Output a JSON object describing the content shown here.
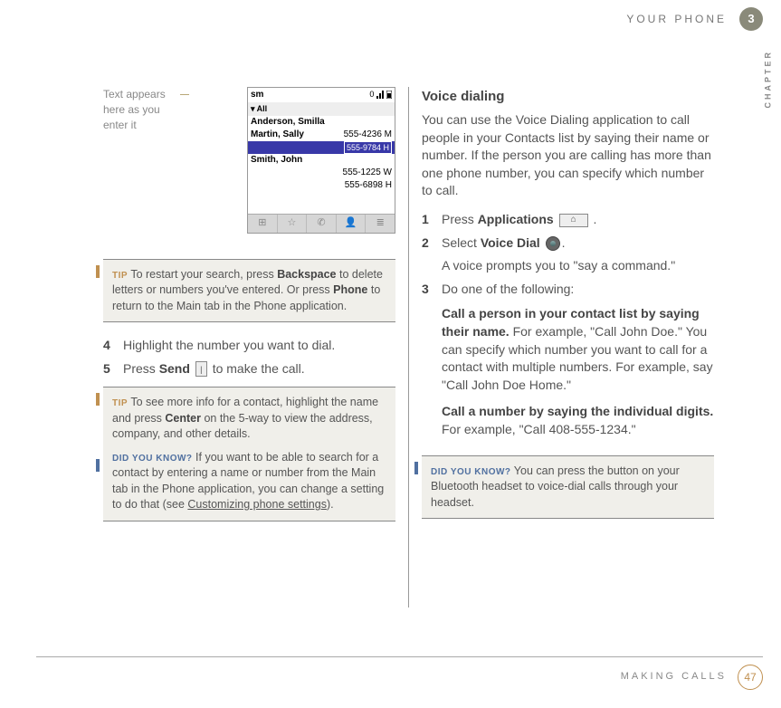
{
  "header": {
    "title": "YOUR PHONE",
    "chapter": "3",
    "side_label": "CHAPTER"
  },
  "footer": {
    "title": "MAKING CALLS",
    "page": "47"
  },
  "left": {
    "callout": "Text appears here as you enter it",
    "phone": {
      "search": "sm",
      "signal": "0",
      "tab": "▾ All",
      "rows": [
        {
          "name": "Anderson, Smilla",
          "num": ""
        },
        {
          "name": "Martin, Sally",
          "num": "555-4236 M"
        },
        {
          "name": "",
          "num": "555-9784 H",
          "hl": true
        },
        {
          "name": "Smith, John",
          "num": ""
        },
        {
          "name": "",
          "num": "555-1225 W"
        },
        {
          "name": "",
          "num": "555-6898 H"
        }
      ],
      "toolbar": [
        "⊞",
        "☆",
        "✆",
        "👤",
        "≣"
      ]
    },
    "tip1": {
      "label": "TIP",
      "t1": "To restart your search, press ",
      "b1": "Backspace",
      "t2": " to delete letters or numbers you've entered. Or press ",
      "b2": "Phone",
      "t3": " to return to the Main tab in the Phone application."
    },
    "steps": [
      {
        "n": "4",
        "text": "Highlight the number you want to dial."
      },
      {
        "n": "5",
        "t1": "Press ",
        "b1": "Send",
        "t2": " to make the call.",
        "icon": "send"
      }
    ],
    "tip2": {
      "label": "TIP",
      "p1a": "To see more info for a contact, highlight the name and press ",
      "p1b": "Center",
      "p1c": " on the 5-way to view the address, company, and other details.",
      "dyk": "DID YOU KNOW?",
      "p2a": "If you want to be able to search for a contact by entering a name or number from the Main tab in the Phone application, you can change a setting to do that (see ",
      "p2link": "Customizing phone settings",
      "p2b": ")."
    }
  },
  "right": {
    "title": "Voice dialing",
    "intro": "You can use the Voice Dialing application to call people in your Contacts list by saying their name or number. If the person you are calling has more than one phone number, you can specify which number to call.",
    "s1": {
      "n": "1",
      "t1": "Press ",
      "b1": "Applications",
      "t2": " ."
    },
    "s2": {
      "n": "2",
      "t1": "Select ",
      "b1": "Voice Dial",
      "t2": ".",
      "p2": "A voice prompts you to \"say a command.\""
    },
    "s3": {
      "n": "3",
      "lead": "Do one of the following:",
      "o1b": "Call a person in your contact list by saying their name.",
      "o1t": " For example, \"Call John Doe.\" You can specify which number you want to call for a contact with multiple numbers. For example, say \"Call John Doe Home.\"",
      "o2b": "Call a number by saying the individual digits.",
      "o2t": " For example, \"Call 408-555-1234.\""
    },
    "dyk": {
      "label": "DID YOU KNOW?",
      "text": "You can press the button on your Bluetooth headset to voice-dial calls through your headset."
    }
  }
}
